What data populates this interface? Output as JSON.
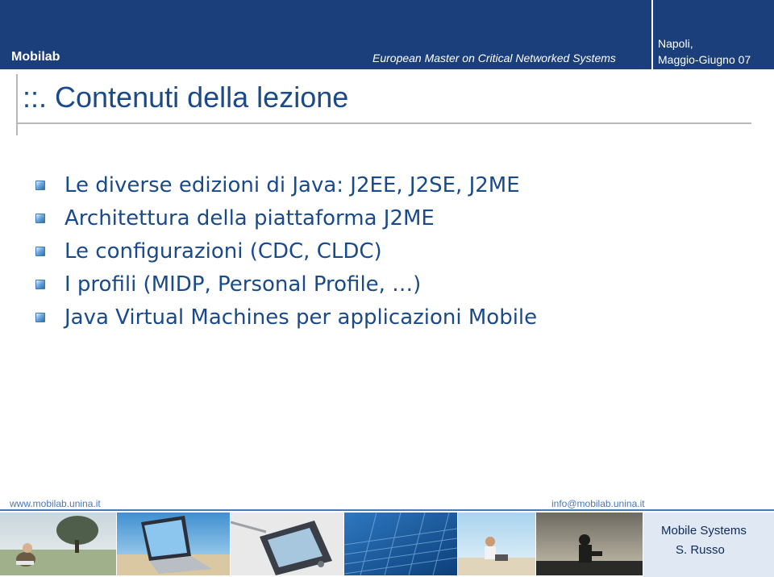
{
  "header": {
    "brand": "Mobilab",
    "course": "European Master on Critical Networked Systems",
    "place_line1": "Napoli,",
    "place_line2": "Maggio-Giugno 07",
    "background_color": "#1a3f7a"
  },
  "slide": {
    "title": "::. Contenuti della lezione",
    "title_color": "#1a4a8a",
    "bullets": [
      "Le diverse edizioni di Java: J2EE, J2SE, J2ME",
      "Architettura della piattaforma J2ME",
      "Le configurazioni (CDC, CLDC)",
      "I profili (MIDP, Personal Profile, …)",
      "Java Virtual Machines per applicazioni Mobile"
    ]
  },
  "footer": {
    "url": "www.mobilab.unina.it",
    "email": "info@mobilab.unina.it",
    "course_name": "Mobile Systems",
    "author": "S. Russo",
    "photos": [
      "tree-field-photo",
      "laptop-beach-photo",
      "pda-device-photo",
      "keyboard-photo",
      "person-laptop-beach-photo",
      "silhouette-sunset-photo"
    ]
  }
}
